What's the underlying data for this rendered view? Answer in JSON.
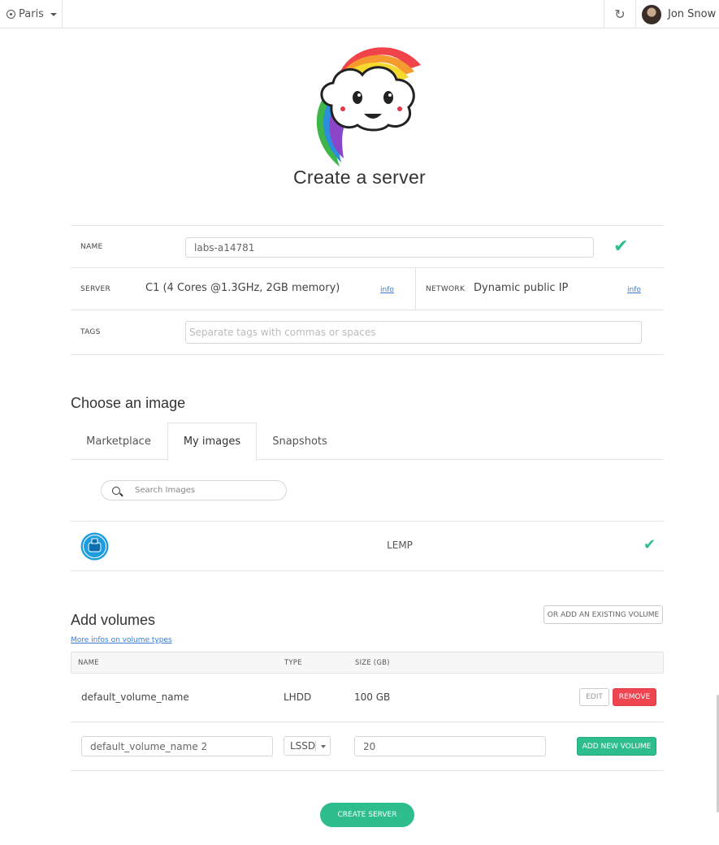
{
  "topbar": {
    "region": "Paris",
    "user_name": "Jon Snow"
  },
  "hero": {
    "title": "Create a server"
  },
  "form": {
    "name_label": "NAME",
    "name_value": "labs-a14781",
    "server_label": "SERVER",
    "server_value": "C1 (4 Cores @1.3GHz, 2GB memory)",
    "server_info": "info",
    "network_label": "NETWORK",
    "network_value": "Dynamic public IP",
    "network_info": "info",
    "tags_label": "TAGS",
    "tags_placeholder": "Separate tags with commas or spaces"
  },
  "images": {
    "title": "Choose an image",
    "tabs": [
      {
        "label": "Marketplace",
        "active": false
      },
      {
        "label": "My images",
        "active": true
      },
      {
        "label": "Snapshots",
        "active": false
      }
    ],
    "search_placeholder": "Search Images",
    "selected": {
      "name": "LEMP"
    }
  },
  "volumes": {
    "title": "Add volumes",
    "more_info": "More infos on volume types",
    "add_existing": "OR ADD AN EXISTING VOLUME",
    "headers": {
      "name": "NAME",
      "type": "TYPE",
      "size": "SIZE (GB)"
    },
    "rows": [
      {
        "name": "default_volume_name",
        "type": "LHDD",
        "size": "100 GB",
        "edit": "EDIT",
        "remove": "REMOVE"
      }
    ],
    "new_row": {
      "name_value": "default_volume_name 2",
      "type_value": "LSSD",
      "size_value": "20",
      "add_button": "ADD NEW VOLUME"
    }
  },
  "actions": {
    "create": "CREATE SERVER"
  },
  "colors": {
    "accent_green": "#2ebd8c",
    "danger_red": "#ee4550",
    "link_blue": "#3b7bd4"
  }
}
